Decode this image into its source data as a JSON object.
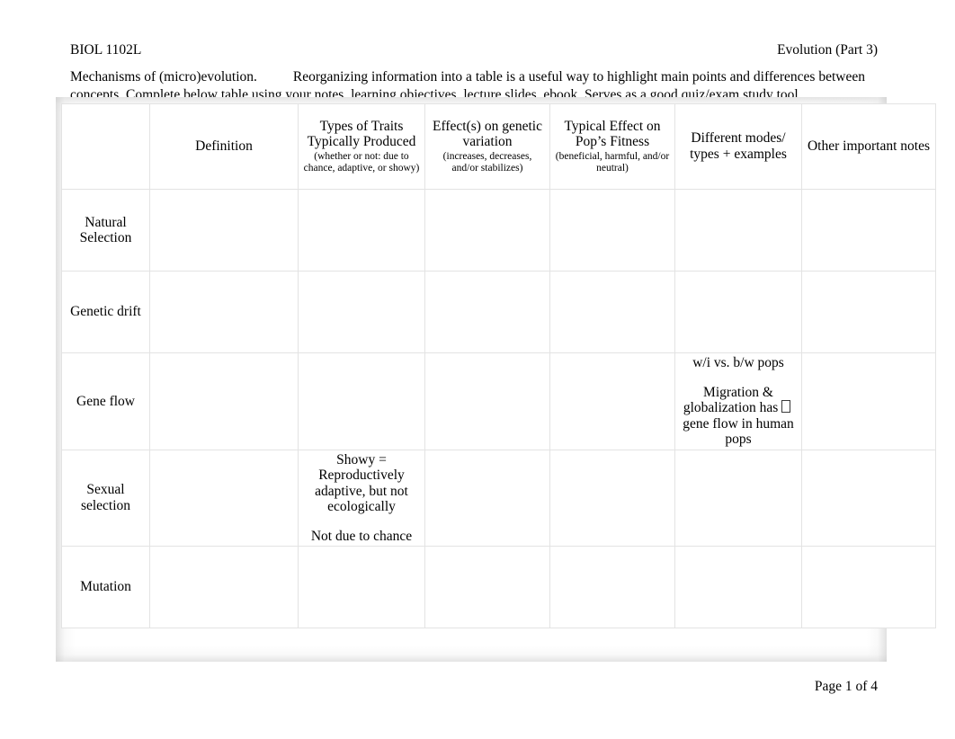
{
  "header": {
    "course_code": "BIOL 1102L",
    "topic": "Evolution (Part 3)"
  },
  "intro": {
    "lead": "Mechanisms of (micro)evolution.",
    "body": "Reorganizing information into a table is a useful way to highlight main points and differences between concepts. Complete below table using your notes, learning objectives, lecture slides, ebook. Serves as a good quiz/exam study tool."
  },
  "table": {
    "corner_label": "",
    "columns": [
      {
        "main": "Definition",
        "sub": ""
      },
      {
        "main": "Types of Traits Typically Produced",
        "sub": "(whether or not: due to chance, adaptive, or showy)"
      },
      {
        "main": "Effect(s) on genetic variation",
        "sub": "(increases, decreases, and/or stabilizes)"
      },
      {
        "main": "Typical Effect on Pop’s Fitness",
        "sub": "(beneficial, harmful, and/or neutral)"
      },
      {
        "main": "Different modes/ types + examples",
        "sub": ""
      },
      {
        "main": "Other important notes",
        "sub": ""
      }
    ],
    "rows": [
      {
        "label": "Natural Selection",
        "cells": [
          {
            "blocks": []
          },
          {
            "blocks": []
          },
          {
            "blocks": []
          },
          {
            "blocks": []
          },
          {
            "blocks": []
          },
          {
            "blocks": []
          }
        ]
      },
      {
        "label": "Genetic drift",
        "cells": [
          {
            "blocks": []
          },
          {
            "blocks": []
          },
          {
            "blocks": []
          },
          {
            "blocks": []
          },
          {
            "blocks": []
          },
          {
            "blocks": []
          }
        ]
      },
      {
        "label": "Gene flow",
        "cells": [
          {
            "blocks": []
          },
          {
            "blocks": []
          },
          {
            "blocks": []
          },
          {
            "blocks": []
          },
          {
            "blocks": [
              {
                "text": "w/i vs. b/w pops",
                "tofu": false
              },
              {
                "text": "Migration & globalization has  gene flow in human pops",
                "tofu": true,
                "pre": "Migration & globalization has",
                "post": "gene flow in human pops"
              }
            ]
          },
          {
            "blocks": []
          }
        ]
      },
      {
        "label": "Sexual selection",
        "cells": [
          {
            "blocks": []
          },
          {
            "blocks": [
              {
                "text": "Showy = Reproductively adaptive, but not ecologically",
                "tofu": false
              },
              {
                "text": "Not due to chance",
                "tofu": false
              }
            ]
          },
          {
            "blocks": []
          },
          {
            "blocks": []
          },
          {
            "blocks": []
          },
          {
            "blocks": []
          }
        ]
      },
      {
        "label": "Mutation",
        "cells": [
          {
            "blocks": []
          },
          {
            "blocks": []
          },
          {
            "blocks": []
          },
          {
            "blocks": []
          },
          {
            "blocks": []
          },
          {
            "blocks": []
          }
        ]
      }
    ]
  },
  "footer": {
    "page_label": "Page 1 of 4"
  }
}
